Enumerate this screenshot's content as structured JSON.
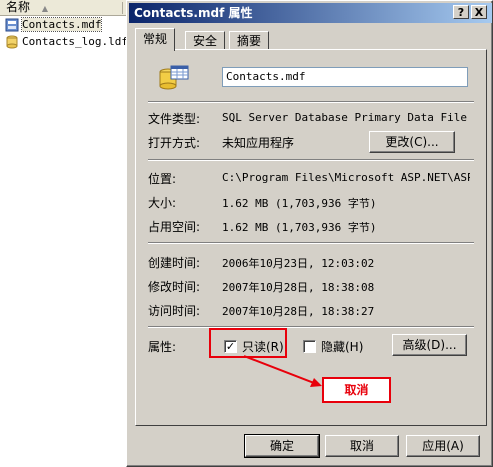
{
  "explorer": {
    "column_name": "名称",
    "files": [
      {
        "name": "Contacts.mdf",
        "icon": "database-file-icon",
        "selected": true
      },
      {
        "name": "Contacts_log.ldf",
        "icon": "log-file-icon",
        "selected": false
      }
    ]
  },
  "dialog": {
    "title": "Contacts.mdf 属性",
    "help_button": "?",
    "close_button": "X",
    "tabs": [
      "常规",
      "安全",
      "摘要"
    ],
    "active_tab": "常规",
    "file_name": "Contacts.mdf",
    "labels": {
      "file_type": "文件类型:",
      "opens_with": "打开方式:",
      "location": "位置:",
      "size": "大小:",
      "size_on_disk": "占用空间:",
      "created": "创建时间:",
      "modified": "修改时间:",
      "accessed": "访问时间:",
      "attributes": "属性:"
    },
    "values": {
      "file_type": "SQL Server Database Primary Data File",
      "opens_with": "未知应用程序",
      "location": "C:\\Program Files\\Microsoft ASP.NET\\ASP.NE",
      "size": "1.62 MB (1,703,936 字节)",
      "size_on_disk": "1.62 MB (1,703,936 字节)",
      "created": "2006年10月23日, 12:03:02",
      "modified": "2007年10月28日, 18:38:08",
      "accessed": "2007年10月28日, 18:38:27"
    },
    "change_button": "更改(C)...",
    "readonly_label": "只读(R)",
    "readonly_checked": true,
    "hidden_label": "隐藏(H)",
    "hidden_checked": false,
    "advanced_button": "高级(D)...",
    "ok_button": "确定",
    "cancel_button": "取消",
    "apply_button": "应用(A)"
  },
  "annotation": {
    "callout_text": "取消",
    "color": "#e8000b"
  },
  "colors": {
    "title_start": "#0a246a",
    "title_end": "#a6caf0",
    "dialog_bg": "#d4d0c8"
  }
}
